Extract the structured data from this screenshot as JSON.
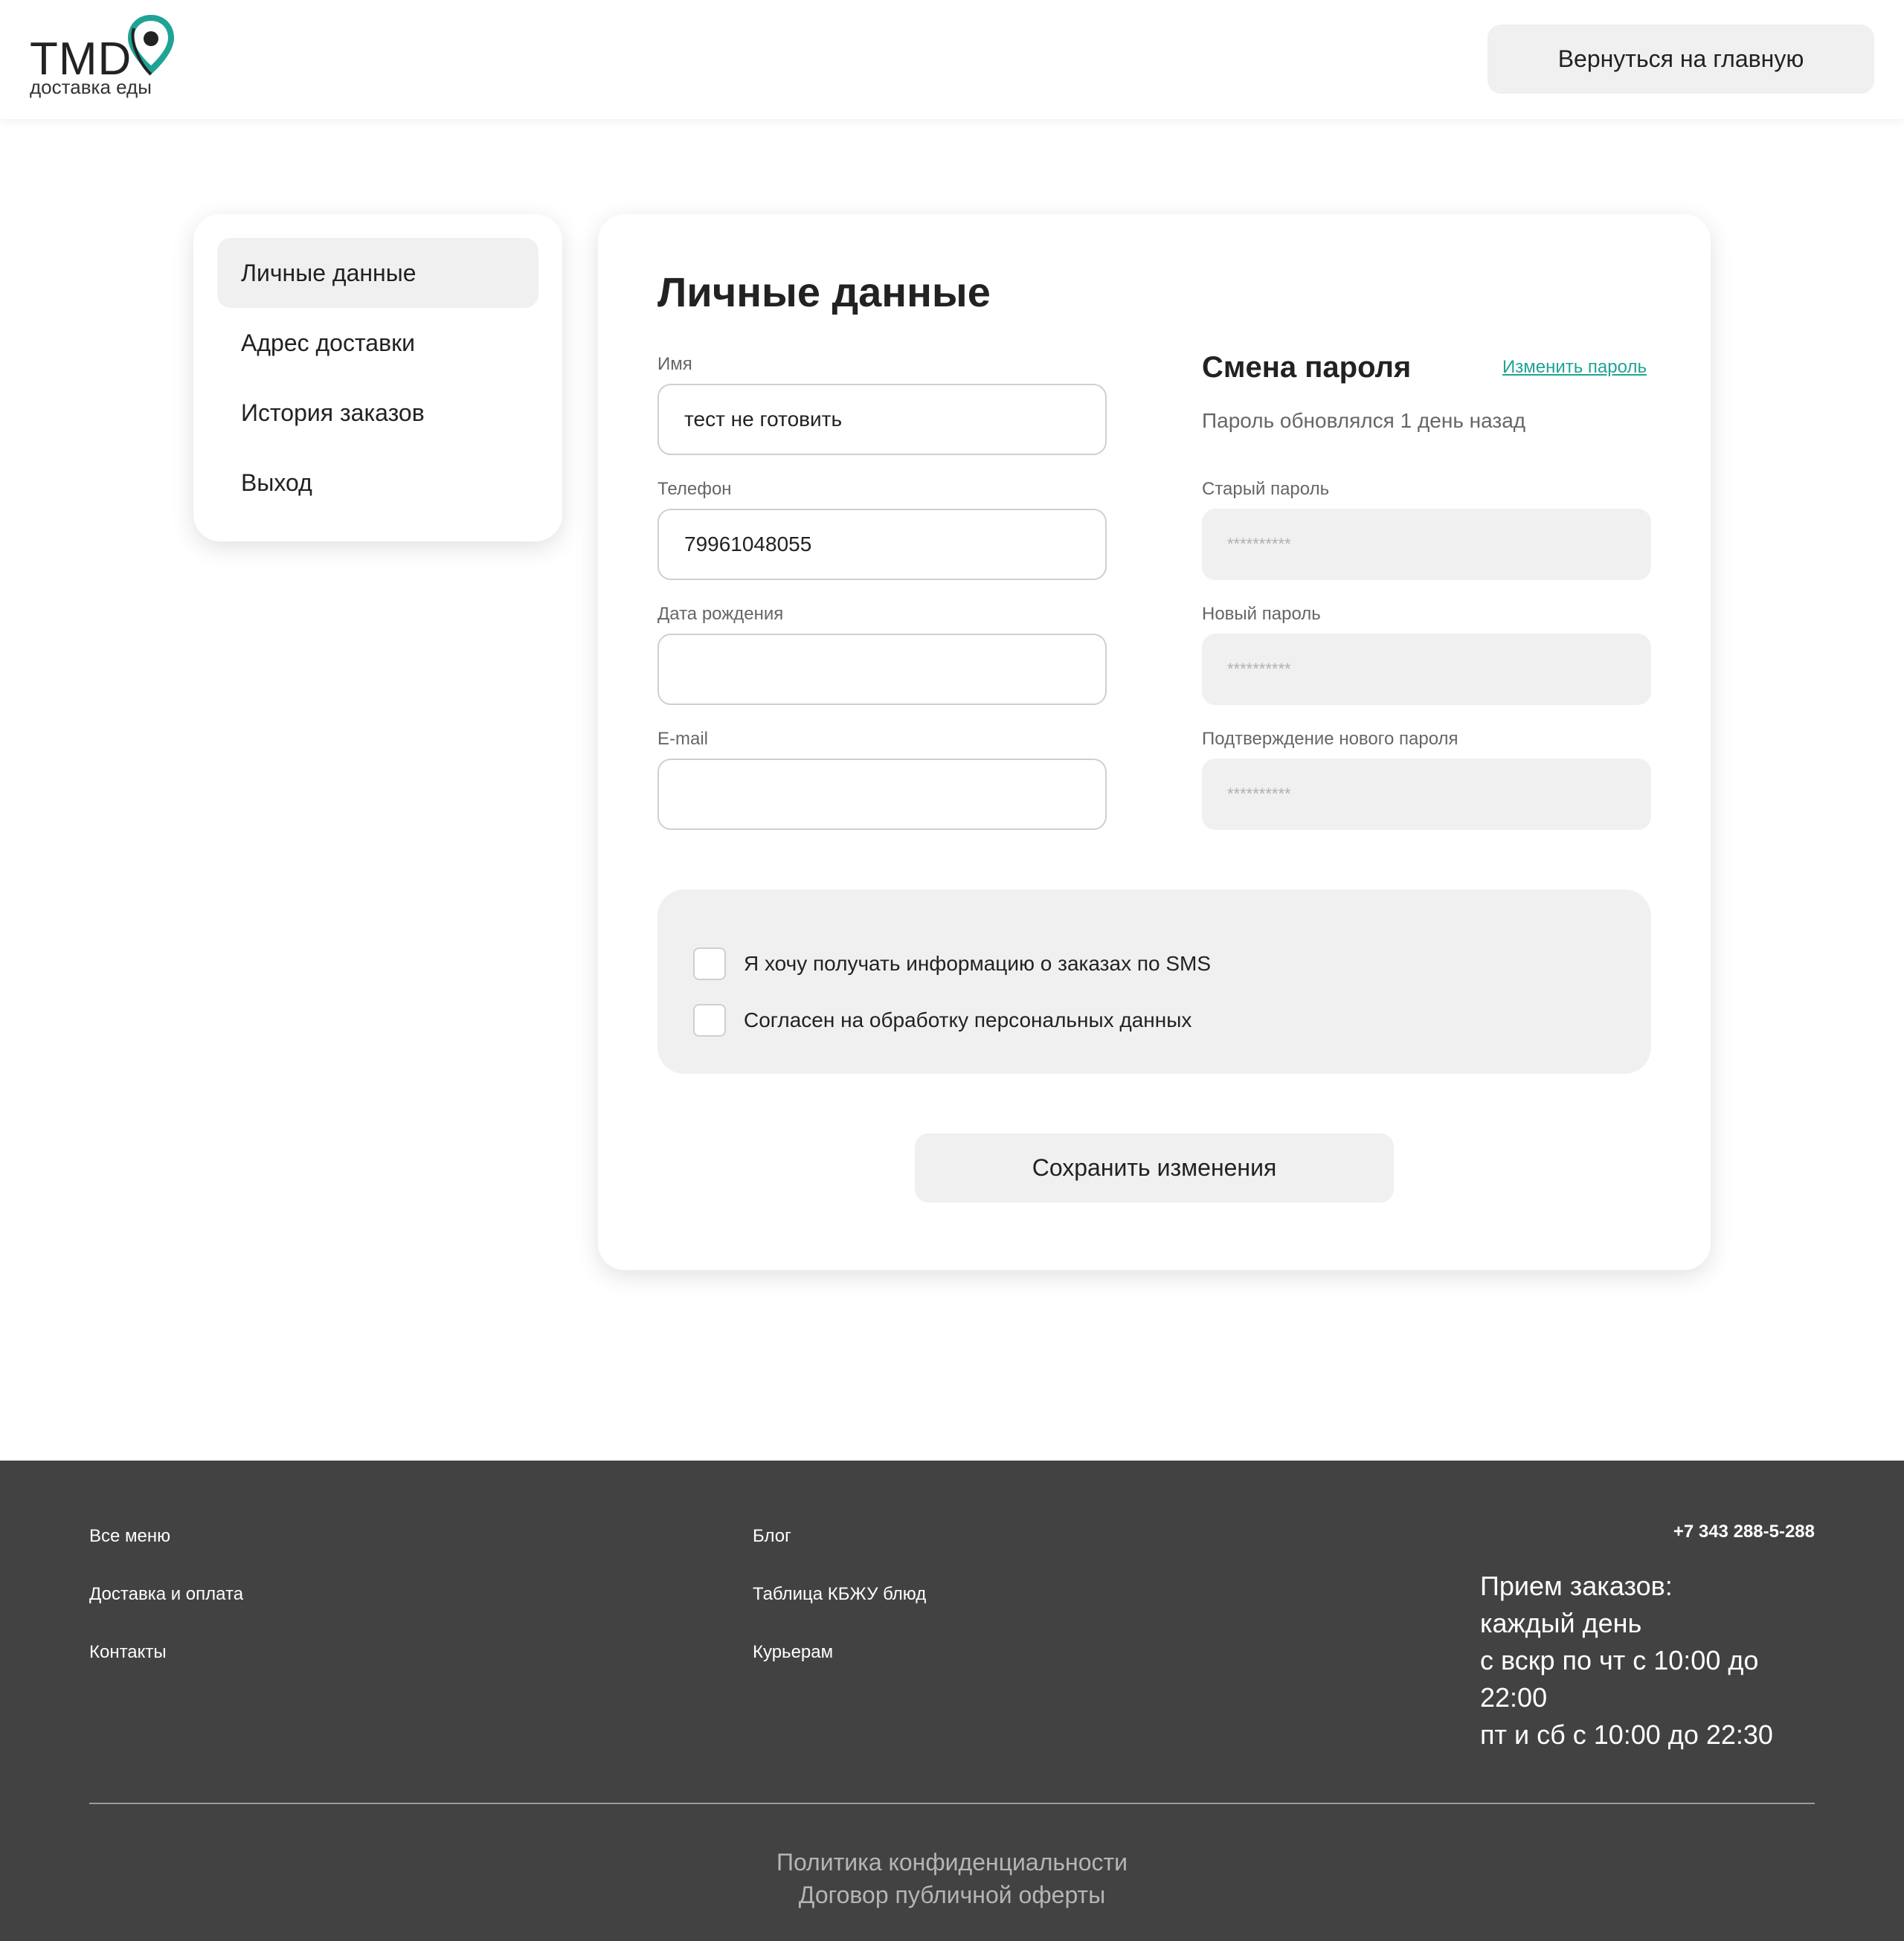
{
  "header": {
    "logo_text": "TMD",
    "logo_sub": "доставка еды",
    "back_label": "Вернуться на главную",
    "brand_color": "#1fa394"
  },
  "sidebar": {
    "items": [
      {
        "label": "Личные данные",
        "active": true
      },
      {
        "label": "Адрес доставки",
        "active": false
      },
      {
        "label": "История заказов",
        "active": false
      },
      {
        "label": "Выход",
        "active": false
      }
    ]
  },
  "main": {
    "title": "Личные данные",
    "fields": {
      "name": {
        "label": "Имя",
        "value": "тест не готовить"
      },
      "phone": {
        "label": "Телефон",
        "value": "79961048055"
      },
      "birthdate": {
        "label": "Дата рождения",
        "value": ""
      },
      "email": {
        "label": "E-mail",
        "value": ""
      }
    },
    "password": {
      "title": "Смена пароля",
      "change_link": "Изменить пароль",
      "updated_info": "Пароль обновлялся 1 день назад",
      "old": {
        "label": "Старый пароль",
        "placeholder": "**********"
      },
      "new": {
        "label": "Новый пароль",
        "placeholder": "**********"
      },
      "confirm": {
        "label": "Подтверждение нового пароля",
        "placeholder": "**********"
      }
    },
    "checkboxes": [
      {
        "label": "Я хочу получать информацию о заказах по SMS",
        "checked": false
      },
      {
        "label": "Согласен на обработку персональных данных",
        "checked": false
      }
    ],
    "save_label": "Сохранить изменения"
  },
  "footer": {
    "col1": [
      "Все меню",
      "Доставка и оплата",
      "Контакты"
    ],
    "col2": [
      "Блог",
      "Таблица КБЖУ блюд",
      "Курьерам"
    ],
    "phone": "+7 343 288-5-288",
    "hours": {
      "line1": "Прием заказов:",
      "line2": "каждый день",
      "line3": "с вскр по чт с 10:00 до 22:00",
      "line4": "пт и сб с 10:00 до 22:30"
    },
    "privacy": "Политика конфиденциальности",
    "offer": "Договор публичной оферты"
  }
}
